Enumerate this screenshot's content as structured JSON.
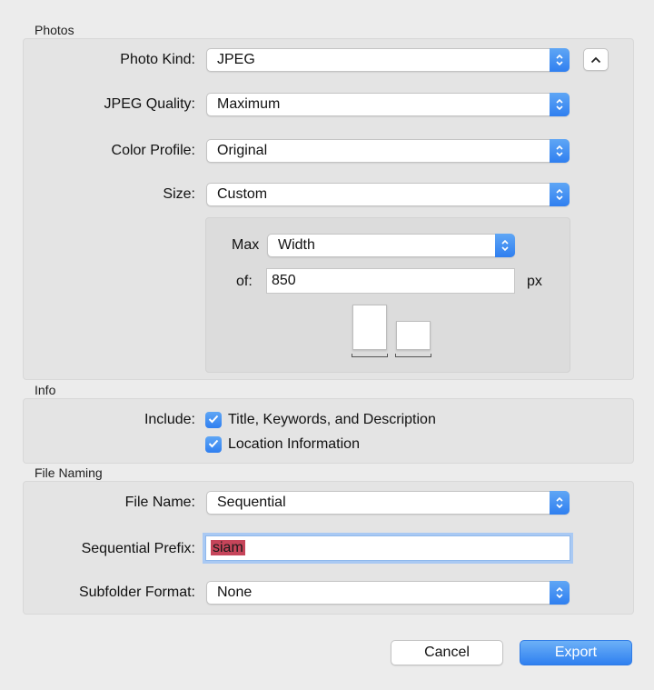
{
  "colors": {
    "accent": "#2f7ff0",
    "selection": "#c6455a",
    "panel": "#e4e4e4",
    "window": "#ececec"
  },
  "photos": {
    "section_title": "Photos",
    "photo_kind": {
      "label": "Photo Kind:",
      "value": "JPEG"
    },
    "jpeg_quality": {
      "label": "JPEG Quality:",
      "value": "Maximum"
    },
    "color_profile": {
      "label": "Color Profile:",
      "value": "Original"
    },
    "size": {
      "label": "Size:",
      "value": "Custom"
    },
    "max": {
      "label": "Max",
      "value": "Width"
    },
    "of": {
      "label": "of:",
      "value": "850",
      "unit": "px"
    },
    "disclosure_icon": "chevron-up-icon"
  },
  "info": {
    "section_title": "Info",
    "include_label": "Include:",
    "checkboxes": [
      {
        "label": "Title, Keywords, and Description",
        "checked": true
      },
      {
        "label": "Location Information",
        "checked": true
      }
    ]
  },
  "file_naming": {
    "section_title": "File Naming",
    "file_name": {
      "label": "File Name:",
      "value": "Sequential"
    },
    "sequential_prefix": {
      "label": "Sequential Prefix:",
      "value": "siam"
    },
    "subfolder_format": {
      "label": "Subfolder Format:",
      "value": "None"
    }
  },
  "buttons": {
    "cancel": "Cancel",
    "export": "Export"
  }
}
